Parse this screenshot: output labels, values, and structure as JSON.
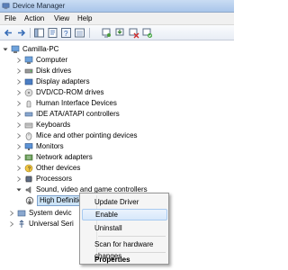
{
  "window": {
    "title": "Device Manager"
  },
  "menu": [
    "File",
    "Action",
    "View",
    "Help"
  ],
  "tree": {
    "root": "Camilla-PC",
    "categories": [
      "Computer",
      "Disk drives",
      "Display adapters",
      "DVD/CD-ROM drives",
      "Human Interface Devices",
      "IDE ATA/ATAPI controllers",
      "Keyboards",
      "Mice and other pointing devices",
      "Monitors",
      "Network adapters",
      "Other devices",
      "Processors",
      "Sound, video and game controllers"
    ],
    "selected_device": "High Definition Audio Device",
    "after": [
      "System devic",
      "Universal Seri"
    ]
  },
  "context_menu": {
    "items": [
      "Update Driver Software...",
      "Enable",
      "Uninstall",
      "Scan for hardware changes",
      "Properties"
    ],
    "highlighted": "Enable",
    "default": "Properties"
  }
}
